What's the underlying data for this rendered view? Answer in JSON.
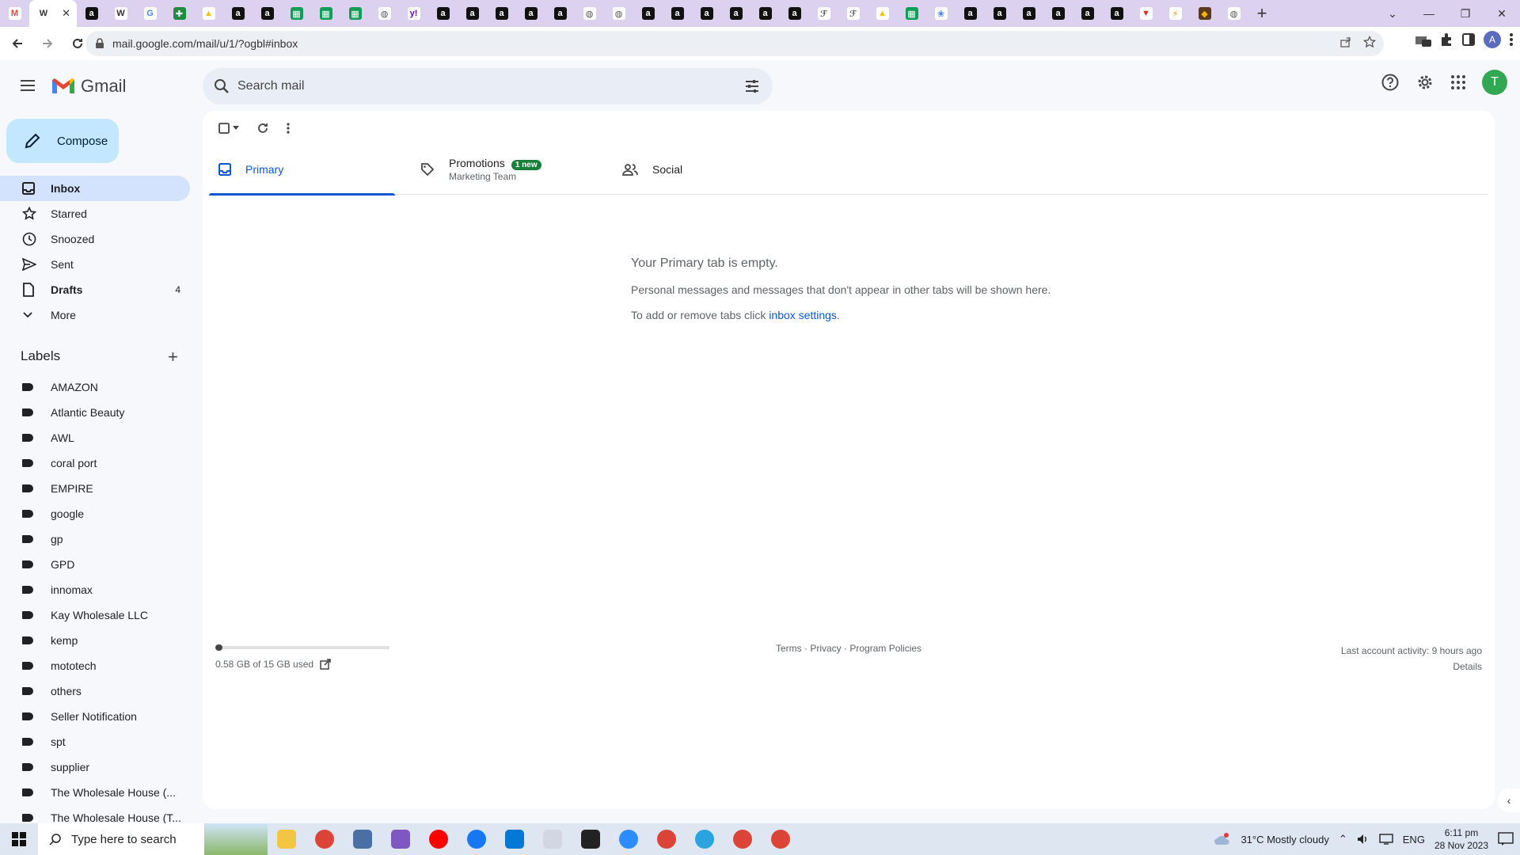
{
  "browser": {
    "url": "mail.google.com/mail/u/1/?ogbl#inbox",
    "tab_favicons": [
      "gmail-icon",
      "wix-icon",
      "amazon-icon",
      "wix-icon",
      "google-icon",
      "extension-icon",
      "drive-icon",
      "amazon-icon",
      "amazon-icon",
      "sheets-icon",
      "sheets-icon",
      "sheets-icon",
      "globe-icon",
      "yahoo-icon",
      "amazon-icon",
      "amazon-icon",
      "amazon-icon",
      "amazon-icon",
      "amazon-icon",
      "globe-icon",
      "globe-icon",
      "amazon-icon",
      "amazon-icon",
      "amazon-icon",
      "amazon-icon",
      "amazon-icon",
      "amazon-icon",
      "cursive-icon",
      "cursive-icon",
      "drive-icon",
      "sheets-icon",
      "photos-icon",
      "amazon-icon",
      "amazon-icon",
      "amazon-icon",
      "amazon-icon",
      "amazon-icon",
      "amazon-icon",
      "red-icon",
      "tools-icon",
      "ups-icon",
      "globe-icon"
    ],
    "profile_initial": "A"
  },
  "gmail": {
    "logo_text": "Gmail",
    "search_placeholder": "Search mail",
    "avatar_initial": "T",
    "compose_label": "Compose",
    "nav": [
      {
        "label": "Inbox",
        "icon": "inbox-icon",
        "active": true,
        "count": ""
      },
      {
        "label": "Starred",
        "icon": "star-icon",
        "active": false,
        "count": ""
      },
      {
        "label": "Snoozed",
        "icon": "clock-icon",
        "active": false,
        "count": ""
      },
      {
        "label": "Sent",
        "icon": "send-icon",
        "active": false,
        "count": ""
      },
      {
        "label": "Drafts",
        "icon": "draft-icon",
        "active": false,
        "count": "4"
      },
      {
        "label": "More",
        "icon": "chevron-down-icon",
        "active": false,
        "count": ""
      }
    ],
    "labels_heading": "Labels",
    "labels": [
      "AMAZON",
      "Atlantic Beauty",
      "AWL",
      "coral port",
      "EMPIRE",
      "google",
      "gp",
      "GPD",
      "innomax",
      "Kay Wholesale LLC",
      "kemp",
      "mototech",
      "others",
      "Seller Notification",
      "spt",
      "supplier",
      "The Wholesale House (...",
      "The Wholesale House (T..."
    ],
    "tabs": [
      {
        "label": "Primary",
        "sub": "",
        "badge": ""
      },
      {
        "label": "Promotions",
        "sub": "Marketing Team",
        "badge": "1 new"
      },
      {
        "label": "Social",
        "sub": "",
        "badge": ""
      }
    ],
    "empty": {
      "title": "Your Primary tab is empty.",
      "line1": "Personal messages and messages that don't appear in other tabs will be shown here.",
      "line2_prefix": "To add or remove tabs click ",
      "line2_link": "inbox settings",
      "line2_suffix": "."
    },
    "storage": {
      "text": "0.58 GB of 15 GB used",
      "fraction": 0.039
    },
    "footer": {
      "terms": "Terms",
      "privacy": "Privacy",
      "policies": "Program Policies",
      "sep": " · "
    },
    "activity": {
      "text": "Last account activity: 9 hours ago",
      "details": "Details"
    }
  },
  "taskbar": {
    "search_placeholder": "Type here to search",
    "weather": "31°C  Mostly cloudy",
    "lang": "ENG",
    "time": "6:11 pm",
    "date": "28 Nov 2023",
    "apps": [
      "file-explorer-icon",
      "chrome-icon",
      "calculator-icon",
      "copilot-icon",
      "youtube-icon",
      "facebook-icon",
      "store-icon",
      "snipping-icon",
      "sticky-notes-icon",
      "zoom-icon",
      "chrome-icon",
      "telegram-icon",
      "chrome-icon",
      "chrome-icon"
    ],
    "colors": {
      "accent": "#0b57d0",
      "compose_bg": "#c2e7ff",
      "active_nav": "#d3e3fd",
      "badge": "#188038"
    }
  }
}
